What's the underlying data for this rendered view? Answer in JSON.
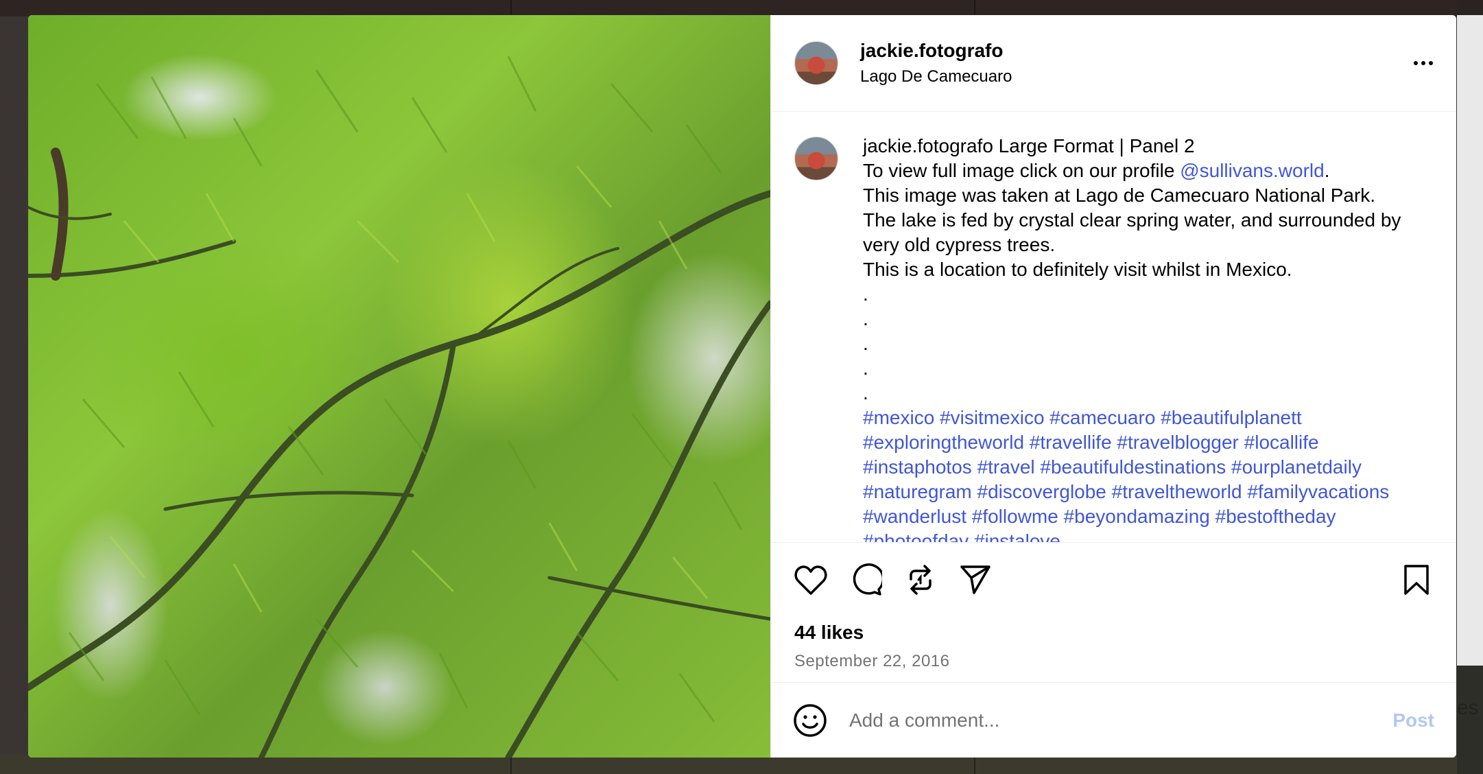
{
  "post": {
    "username": "jackie.fotografo",
    "location": "Lago De Camecuaro"
  },
  "caption": {
    "username": "jackie.fotografo",
    "line1_rest": " Large Format | Panel 2",
    "line2_prefix": "To view full image click on our profile ",
    "mention": "@sullivans.world",
    "line2_suffix": ".",
    "line3": "This image was taken at Lago de Camecuaro National Park.",
    "line4": "The lake is fed by crystal clear spring water, and surrounded by very old cypress trees.",
    "line5": "This is a location to definitely visit whilst in Mexico.",
    "dots": [
      ".",
      ".",
      ".",
      ".",
      "."
    ],
    "hashtags": "#mexico #visitmexico #camecuaro #beautifulplanett #exploringtheworld #travellife #travelblogger #locallife #instaphotos #travel #beautifuldestinations #ourplanetdaily #naturegram #discoverglobe #traveltheworld #familyvacations #wanderlust #followme #beyondamazing #bestoftheday #photoofday #instalove"
  },
  "stats": {
    "likes": "44 likes",
    "date": "September 22, 2016"
  },
  "comment": {
    "placeholder": "Add a comment...",
    "post_label": "Post"
  },
  "background_peek_text": "es",
  "icons": {
    "more": "more-options-icon",
    "like": "heart-icon",
    "comment": "comment-icon",
    "repost": "repost-icon",
    "share": "send-icon",
    "save": "bookmark-icon",
    "emoji": "emoji-icon"
  },
  "colors": {
    "link": "#4056d6",
    "post_disabled": "#b2c8f2",
    "secondary_text": "#737373"
  }
}
